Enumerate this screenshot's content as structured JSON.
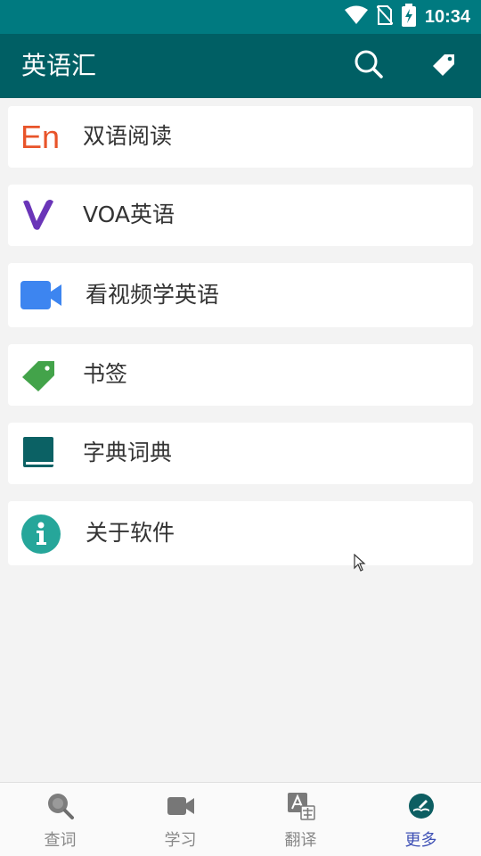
{
  "status_bar": {
    "time": "10:34",
    "icons": [
      "wifi-icon",
      "no-sim-icon",
      "battery-charging-icon"
    ]
  },
  "app_bar": {
    "title": "英语汇",
    "actions": [
      "search-icon",
      "tag-icon"
    ]
  },
  "menu": {
    "items": [
      {
        "label": "双语阅读",
        "icon": "en-text-icon",
        "icon_text": "En",
        "color": "#e8542a"
      },
      {
        "label": "VOA英语",
        "icon": "voa-v-icon",
        "color": "#6a35b8"
      },
      {
        "label": "看视频学英语",
        "icon": "video-camera-icon",
        "color": "#3d85f0"
      },
      {
        "label": "书签",
        "icon": "bookmark-tag-icon",
        "color": "#43a34a"
      },
      {
        "label": "字典词典",
        "icon": "book-icon",
        "color": "#0b6164"
      },
      {
        "label": "关于软件",
        "icon": "info-icon",
        "color": "#26a69a"
      }
    ]
  },
  "bottom_nav": {
    "items": [
      {
        "label": "查词",
        "icon": "magnifier-icon"
      },
      {
        "label": "学习",
        "icon": "video-icon"
      },
      {
        "label": "翻译",
        "icon": "translate-icon"
      },
      {
        "label": "更多",
        "icon": "more-reading-icon",
        "active": true
      }
    ],
    "active_color": "#3f51b5",
    "inactive_color": "#888888"
  },
  "colors": {
    "status_bar": "#007a80",
    "app_bar": "#005f64",
    "background": "#f3f3f3"
  }
}
